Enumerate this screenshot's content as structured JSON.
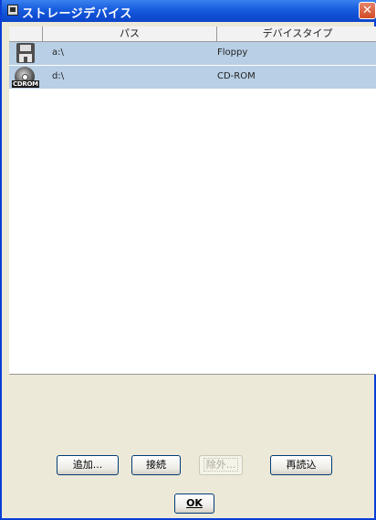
{
  "window": {
    "title": "ストレージデバイス",
    "close_glyph": "✕"
  },
  "table": {
    "columns": [
      "",
      "パス",
      "デバイスタイプ"
    ],
    "rows": [
      {
        "icon": "floppy-disk-icon",
        "path": "a:\\",
        "type": "Floppy"
      },
      {
        "icon": "cdrom-icon",
        "icon_text": "CDROM",
        "path": "d:\\",
        "type": "CD-ROM"
      }
    ]
  },
  "buttons": {
    "add": "追加...",
    "connect": "接続",
    "remove": "除外...",
    "reload": "再読込",
    "ok": "OK"
  },
  "colors": {
    "titlebar": "#0f4fd4",
    "selected_row": "#b8cfe5",
    "window_bg": "#ece9d8"
  }
}
